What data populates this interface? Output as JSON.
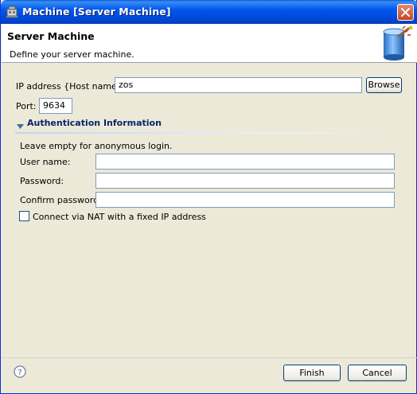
{
  "window": {
    "title": "Machine [Server Machine]"
  },
  "banner": {
    "title": "Server Machine",
    "description": "Define your server machine."
  },
  "form": {
    "ip_label": "IP address {Host name}:",
    "ip_value": "zos",
    "browse_label": "Browse",
    "port_label": "Port:",
    "port_value": "9634"
  },
  "auth_section": {
    "title": "Authentication Information",
    "hint": "Leave empty for anonymous login.",
    "user_label": "User name:",
    "user_value": "",
    "password_label": "Password:",
    "password_value": "",
    "confirm_label": "Confirm password:",
    "confirm_value": "",
    "nat_label": "Connect via NAT with a fixed IP address",
    "nat_checked": false
  },
  "footer": {
    "finish_label": "Finish",
    "cancel_label": "Cancel"
  },
  "icons": {
    "title": "machine-icon",
    "close": "close-icon",
    "banner": "server-machine-icon",
    "section": "triangle-down-icon",
    "help": "help-icon"
  }
}
